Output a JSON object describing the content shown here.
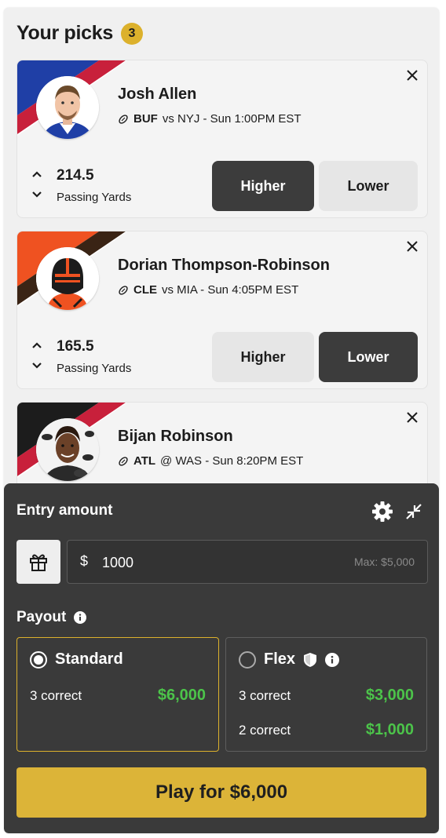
{
  "header": {
    "title": "Your picks",
    "count": "3"
  },
  "picks": [
    {
      "name": "Josh Allen",
      "team": "BUF",
      "matchup_rest": "vs NYJ - Sun 1:00PM EST",
      "stat_value": "214.5",
      "stat_label": "Passing Yards",
      "higher_label": "Higher",
      "lower_label": "Lower",
      "selected": "Higher",
      "team_colors": {
        "primary": "#1f3fa6",
        "secondary": "#c8203b"
      }
    },
    {
      "name": "Dorian Thompson-Robinson",
      "team": "CLE",
      "matchup_rest": "vs MIA - Sun 4:05PM EST",
      "stat_value": "165.5",
      "stat_label": "Passing Yards",
      "higher_label": "Higher",
      "lower_label": "Lower",
      "selected": "Lower",
      "team_colors": {
        "primary": "#ef5221",
        "secondary": "#3a2415"
      }
    },
    {
      "name": "Bijan Robinson",
      "team": "ATL",
      "matchup_rest": "@ WAS - Sun 8:20PM EST",
      "team_colors": {
        "primary": "#1c1c1c",
        "secondary": "#c8203b"
      }
    }
  ],
  "entry": {
    "title": "Entry amount",
    "currency": "$",
    "amount": "1000",
    "max_label": "Max: $5,000",
    "payout_title": "Payout",
    "options": {
      "standard": {
        "label": "Standard",
        "selected": true,
        "rows": [
          {
            "label": "3 correct",
            "amount": "$6,000"
          }
        ]
      },
      "flex": {
        "label": "Flex",
        "selected": false,
        "rows": [
          {
            "label": "3 correct",
            "amount": "$3,000"
          },
          {
            "label": "2 correct",
            "amount": "$1,000"
          }
        ]
      }
    },
    "play_label": "Play for $6,000"
  },
  "colors": {
    "accent": "#dcb12c",
    "payout_green": "#4cc44a",
    "dark_panel": "#3a3a3a"
  }
}
